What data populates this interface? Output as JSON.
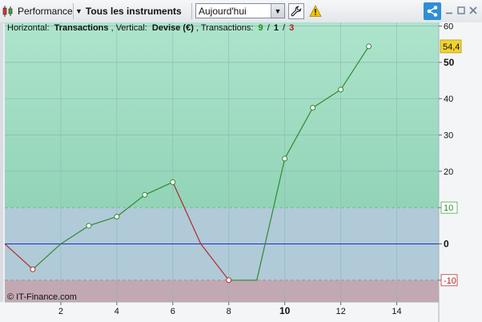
{
  "toolbar": {
    "performance_label": "Performance",
    "instruments_label": "Tous les instruments",
    "period_value": "Aujourd'hui",
    "icons": {
      "performance": "candlestick-icon",
      "dropdown": "triangle-down-icon",
      "settings": "wrench-icon",
      "warning": "warning-icon",
      "share": "share-icon",
      "minimize": "minimize-icon",
      "maximize": "maximize-icon",
      "close": "close-icon"
    }
  },
  "chart_header": {
    "horizontal_label": "Horizontal:",
    "horizontal_value": "Transactions",
    "vertical_label": "Vertical:",
    "vertical_value": "Devise (€)",
    "transactions_label": "Transactions:",
    "count_green": "9",
    "count_black": "1",
    "count_red": "3",
    "slash": "/"
  },
  "watermark": "© IT-Finance.com",
  "colors": {
    "zone_green": "#a4e0c8",
    "zone_blue": "#b0cad8",
    "zone_red": "#c2a8b2",
    "line_up": "#2e8b2e",
    "line_down": "#b02a2a",
    "zero_line": "#1f2fd0",
    "last_value_badge": "#f2d22e",
    "accent": "#2f8ed8"
  },
  "chart_data": {
    "type": "line",
    "x": [
      0,
      1,
      2,
      3,
      4,
      5,
      6,
      7,
      8,
      9,
      10,
      11,
      12,
      13
    ],
    "y": [
      0,
      -7,
      0,
      5,
      7.5,
      13.5,
      17,
      0,
      -10,
      -10,
      23.5,
      37.5,
      42.5,
      54.4
    ],
    "markers": [
      1,
      3,
      4,
      5,
      6,
      8,
      10,
      11,
      12,
      13
    ],
    "xlim": [
      0,
      15.5
    ],
    "ylim": [
      -16,
      61
    ],
    "xticks": [
      2,
      4,
      6,
      8,
      10,
      12,
      14
    ],
    "xticks_bold": [
      10
    ],
    "yticks": [
      60,
      50,
      40,
      30,
      20,
      10,
      0,
      -10
    ],
    "yticks_bold": [
      50,
      0
    ],
    "zones": [
      {
        "name": "gain",
        "from": 10,
        "to": 61
      },
      {
        "name": "neutral",
        "from": -10,
        "to": 10
      },
      {
        "name": "loss",
        "from": -16,
        "to": -10
      }
    ],
    "threshold_labels": [
      "10",
      "-10"
    ],
    "last_value": "54,4",
    "grid": true
  }
}
